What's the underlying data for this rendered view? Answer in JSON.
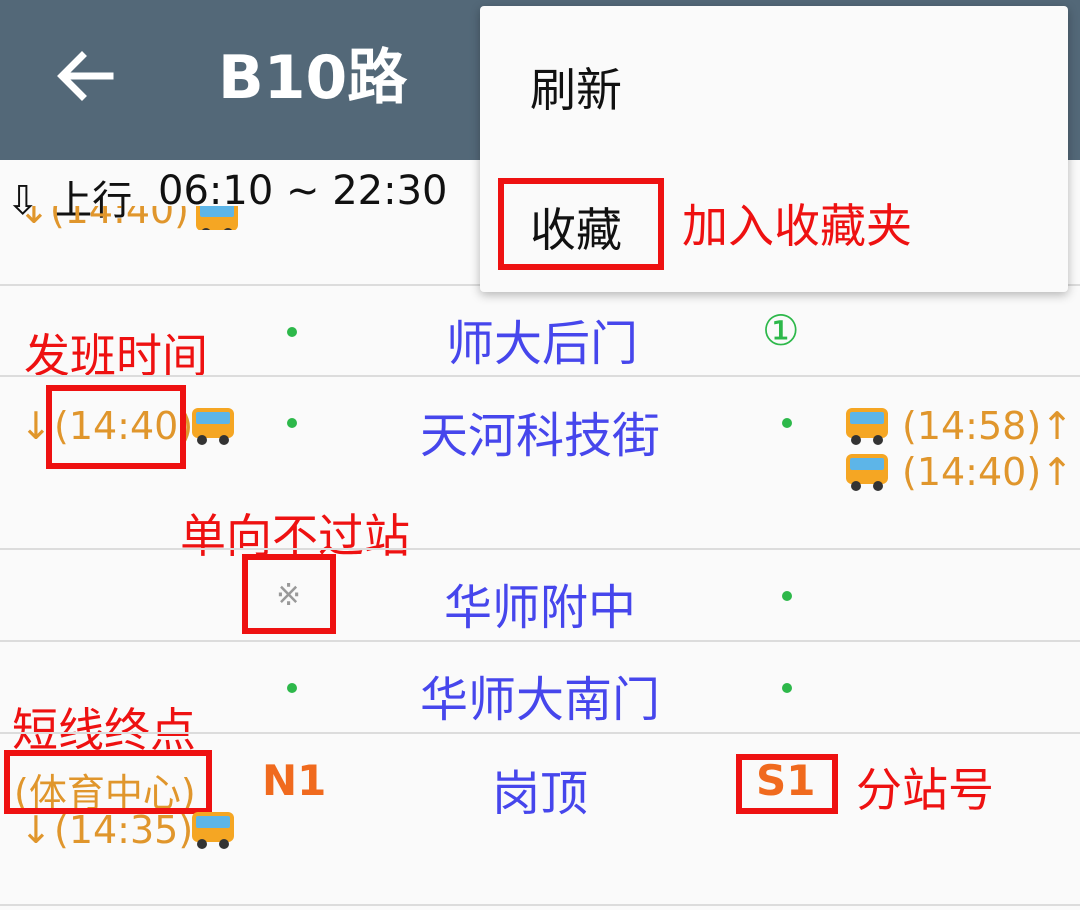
{
  "appbar": {
    "title": "B10路"
  },
  "header": {
    "direction_label": "⇩ 上行",
    "service_hours": "06:10 ~ 22:30"
  },
  "menu": {
    "items": [
      {
        "label": "刷新"
      },
      {
        "label": "收藏"
      }
    ]
  },
  "annotations": {
    "favorite": "加入收藏夹",
    "departure_time": "发班时间",
    "one_way": "单向不过站",
    "short_terminus": "短线终点",
    "substation_no": "分站号"
  },
  "partial_row": {
    "text": "↓(14:40)"
  },
  "stations": [
    {
      "name": "师大后门",
      "right_marker": "①"
    },
    {
      "name": "天河科技街",
      "left_arrow": "↓",
      "left_time": "(14:40)",
      "right_bus_1": "(14:58)↑",
      "right_bus_2": "(14:40)↑"
    },
    {
      "name": "华师附中",
      "left_marker": "※"
    },
    {
      "name": "华师大南门"
    },
    {
      "name": "岗顶",
      "left_label": "(体育中心)",
      "left_arrow": "↓",
      "left_time": "(14:35)",
      "left_code": "N1",
      "right_code": "S1"
    }
  ],
  "colors": {
    "appbar": "#536878",
    "station": "#4646ec",
    "time": "#e0962c",
    "annotation": "#ee1111",
    "dot": "#2db84a",
    "code": "#f06a1e"
  }
}
